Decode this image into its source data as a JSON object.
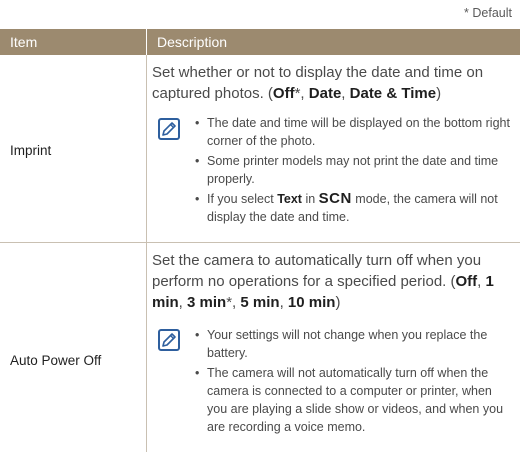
{
  "default_note": "* Default",
  "header": {
    "item": "Item",
    "description": "Description"
  },
  "rows": [
    {
      "item": "Imprint",
      "desc_parts": [
        "Set whether or not to display the date and time on captured photos. (",
        "Off",
        "*, ",
        "Date",
        ", ",
        "Date & Time",
        ")"
      ],
      "notes": [
        "The date and time will be displayed on the bottom right corner of the photo.",
        "Some printer models may not print the date and time properly.",
        {
          "pre": "If you select ",
          "bold": "Text",
          "mid": " in ",
          "mode": "SCN",
          "post": " mode, the camera will not display the date and time."
        }
      ]
    },
    {
      "item": "Auto Power Off",
      "desc_parts": [
        "Set the camera to automatically turn off when you perform no operations for a specified period. (",
        "Off",
        ", ",
        "1 min",
        ", ",
        "3 min",
        "*, ",
        "5 min",
        ", ",
        "10 min",
        ")"
      ],
      "notes": [
        "Your settings will not change when you replace the battery.",
        "The camera will not automatically turn off when the camera is connected to a computer or printer, when you are playing a slide show or videos, and when you are recording a voice memo."
      ]
    }
  ],
  "icon": "note-pencil-icon",
  "colors": {
    "header_bg": "#9c8a6f",
    "icon_blue": "#2e5f9e"
  }
}
